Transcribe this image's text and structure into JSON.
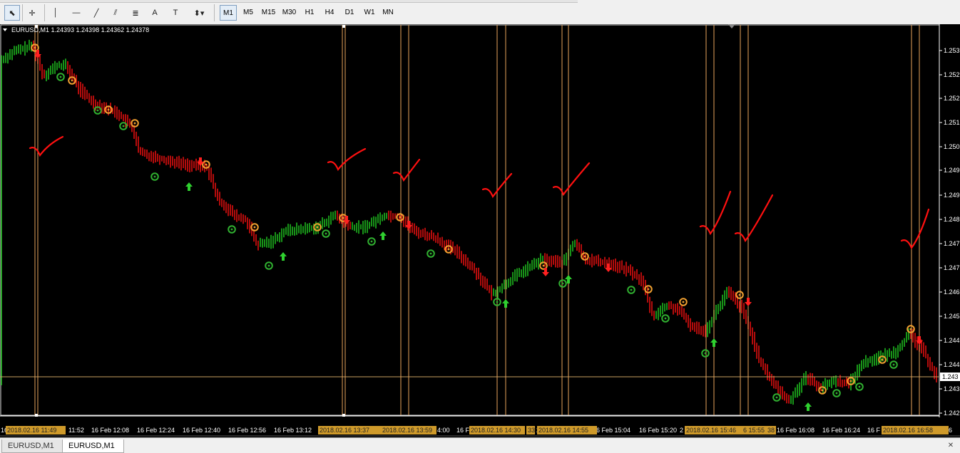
{
  "toolbar": {
    "tools": [
      {
        "name": "cursor-tool",
        "glyph": "⬉"
      },
      {
        "name": "crosshair-tool",
        "glyph": "✛"
      },
      {
        "name": "vertical-line-tool",
        "glyph": "│"
      },
      {
        "name": "horizontal-line-tool",
        "glyph": "—"
      },
      {
        "name": "trendline-tool",
        "glyph": "╱"
      },
      {
        "name": "equidistant-channel-tool",
        "glyph": "⫽"
      },
      {
        "name": "fibonacci-tool",
        "glyph": "≣"
      },
      {
        "name": "text-tool",
        "glyph": "A"
      },
      {
        "name": "text-label-tool",
        "glyph": "T"
      },
      {
        "name": "arrows-tool",
        "glyph": "⬍▾"
      }
    ],
    "timeframes": [
      "M1",
      "M5",
      "M15",
      "M30",
      "H1",
      "H4",
      "D1",
      "W1",
      "MN"
    ],
    "active_timeframe": "M1"
  },
  "chart": {
    "header": "EURUSD,M1  1.24393 1.24398 1.24362 1.24378",
    "current_price": "1.243",
    "price_ticks": [
      "1.253",
      "1.252",
      "1.252",
      "1.251",
      "1.250",
      "1.249",
      "1.249",
      "1.248",
      "1.247",
      "1.247",
      "1.246",
      "1.245",
      "1.244",
      "1.244",
      "1.243",
      "1.242"
    ],
    "time_labels": [
      "16",
      "11:52",
      "16 Feb 12:08",
      "16 Feb 12:24",
      "16 Feb 12:40",
      "16 Feb 12:56",
      "16 Feb 13:12",
      "2",
      "4:00",
      "16 F",
      "2",
      "6 Feb 15:04",
      "16 Feb 15:20",
      "2",
      "16 Feb 16:08",
      "16 Feb 16:24",
      "16 F",
      "6"
    ],
    "highlight_labels": [
      "2018.02.16 11:49",
      "2018.02.16 13:37",
      "2018.02.16 13:59",
      "2018.02.16 14:30",
      "33",
      "2018.02.16 14:55",
      "2018.02.16 15:46",
      "6 15:55",
      "38",
      "2018.02.16 16:58"
    ],
    "colors": {
      "bg": "#000000",
      "bull": "#1fb81f",
      "bear": "#e01010",
      "vline": "#e8a35c",
      "highlight": "#cf9a2a",
      "annotation": "#ff1010"
    }
  },
  "bottom_tabs": [
    {
      "label": "EURUSD,M1",
      "active": false
    },
    {
      "label": "EURUSD,M1",
      "active": true
    }
  ]
}
